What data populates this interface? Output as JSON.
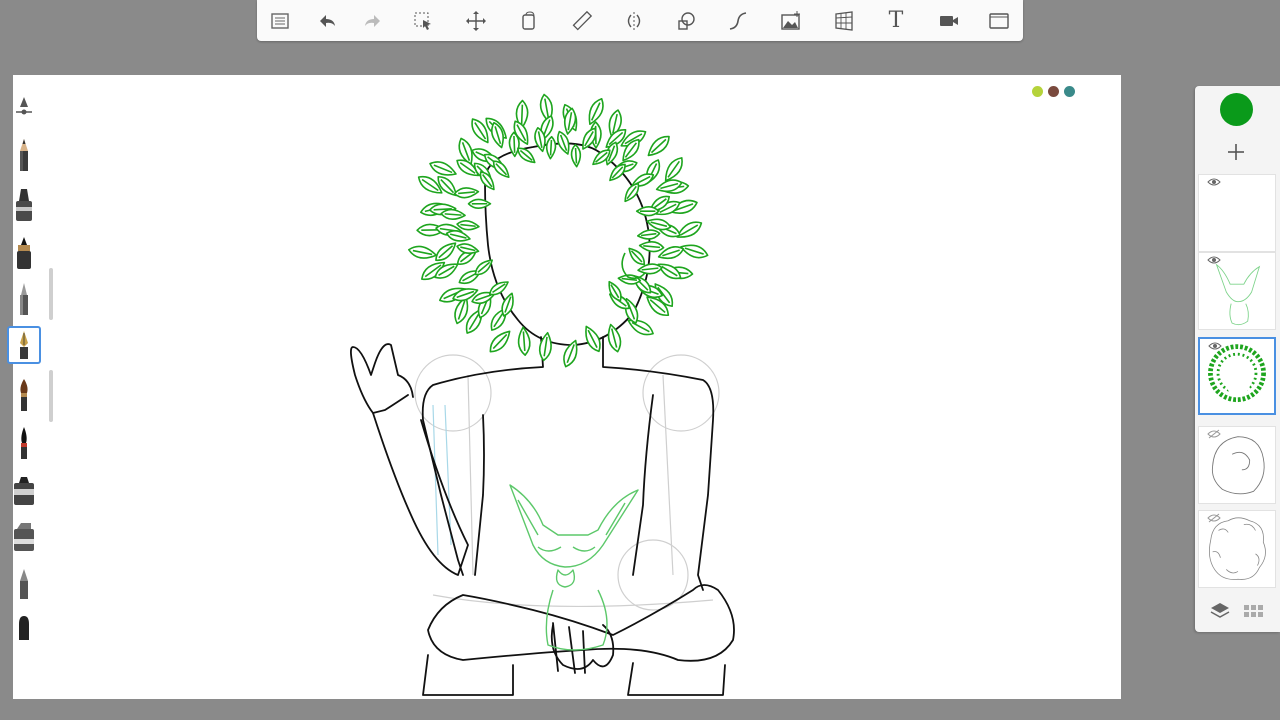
{
  "toolbar": {
    "tools": [
      {
        "name": "layer-menu-icon"
      },
      {
        "name": "undo-icon"
      },
      {
        "name": "redo-icon"
      },
      {
        "name": "selection-icon"
      },
      {
        "name": "transform-icon"
      },
      {
        "name": "fill-icon"
      },
      {
        "name": "ruler-icon"
      },
      {
        "name": "symmetry-icon"
      },
      {
        "name": "shape-icon"
      },
      {
        "name": "curve-icon"
      },
      {
        "name": "image-icon"
      },
      {
        "name": "perspective-icon"
      },
      {
        "name": "text-icon",
        "label": "T"
      },
      {
        "name": "record-icon"
      },
      {
        "name": "fullscreen-icon"
      }
    ]
  },
  "brushes": [
    {
      "name": "brush-size-slider-icon"
    },
    {
      "name": "pencil-brush-icon"
    },
    {
      "name": "marker-brush-icon"
    },
    {
      "name": "ink-pen-brush-icon"
    },
    {
      "name": "ballpoint-brush-icon"
    },
    {
      "name": "fountain-pen-brush-icon",
      "selected": true
    },
    {
      "name": "paintbrush-brush-icon"
    },
    {
      "name": "ink-brush-icon"
    },
    {
      "name": "chisel-marker-brush-icon"
    },
    {
      "name": "flat-marker-brush-icon"
    },
    {
      "name": "airbrush-brush-icon"
    },
    {
      "name": "smudge-brush-icon"
    }
  ],
  "colors": {
    "current": "#0a9a1a",
    "puck": [
      "#b5d33b",
      "#7a4a3e",
      "#3a8a8a"
    ],
    "hair": "#1ea51e",
    "fox": "#5cc86a",
    "accent": "#4a90e2"
  },
  "layers": [
    {
      "name": "layer-empty",
      "visible": true
    },
    {
      "name": "layer-fox-sketch",
      "visible": true
    },
    {
      "name": "layer-hair",
      "visible": true,
      "active": true
    },
    {
      "name": "layer-head-sketch",
      "visible": false
    },
    {
      "name": "layer-curly-sketch",
      "visible": false
    }
  ]
}
